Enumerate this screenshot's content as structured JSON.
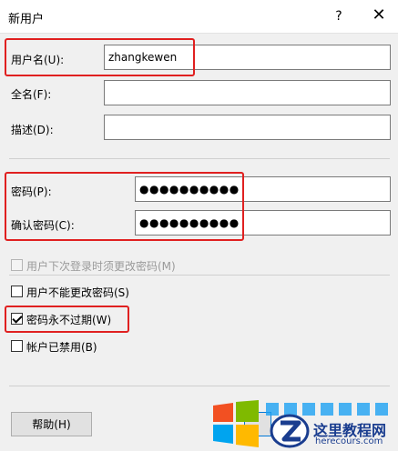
{
  "window": {
    "title": "新用户",
    "help_glyph": "?",
    "close_glyph": "✕"
  },
  "fields": {
    "username": {
      "label": "用户名(U):",
      "value": "zhangkewen"
    },
    "fullname": {
      "label": "全名(F):",
      "value": ""
    },
    "description": {
      "label": "描述(D):",
      "value": ""
    },
    "password": {
      "label": "密码(P):",
      "value": "●●●●●●●●●●"
    },
    "confirm_password": {
      "label": "确认密码(C):",
      "value": "●●●●●●●●●●"
    }
  },
  "options": {
    "must_change": {
      "label": "用户下次登录时须更改密码(M)",
      "checked": false,
      "disabled": true
    },
    "cannot_change": {
      "label": "用户不能更改密码(S)",
      "checked": false,
      "disabled": false
    },
    "never_expires": {
      "label": "密码永不过期(W)",
      "checked": true,
      "disabled": false
    },
    "disabled_account": {
      "label": "帐户已禁用(B)",
      "checked": false,
      "disabled": false
    }
  },
  "buttons": {
    "help": "帮助(H)"
  },
  "watermark": {
    "name": "这里教程网",
    "site": "herecours.com"
  },
  "colors": {
    "highlight": "#e02020",
    "accent": "#0078d7"
  }
}
